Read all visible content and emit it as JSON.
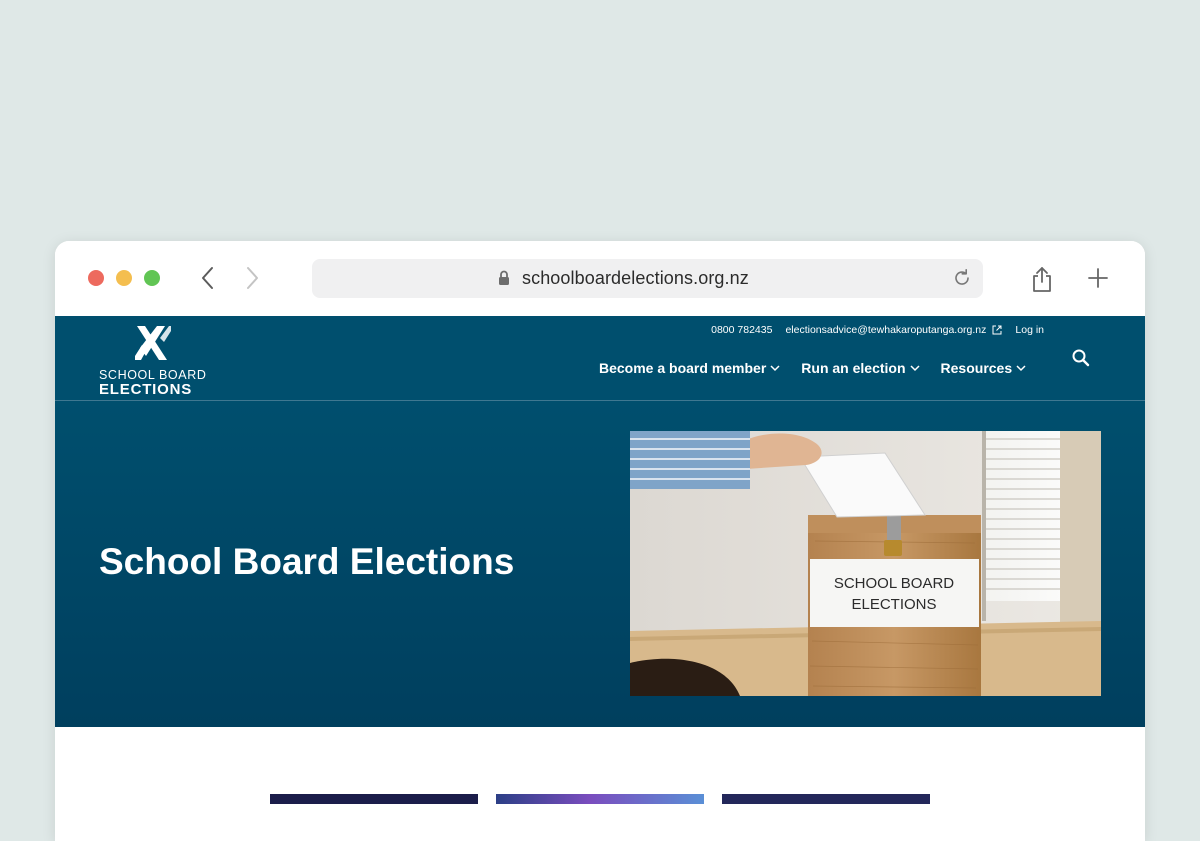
{
  "browser": {
    "url": "schoolboardelections.org.nz",
    "icons": {
      "back": "chevron-left-icon",
      "forward": "chevron-right-icon",
      "lock": "lock-icon",
      "reload": "reload-icon",
      "share": "share-icon",
      "new_tab": "plus-icon"
    }
  },
  "header": {
    "logo": {
      "line1": "SCHOOL BOARD",
      "line2": "ELECTIONS"
    },
    "utility": {
      "phone": "0800 782435",
      "email": "electionsadvice@tewhakaroputanga.org.nz",
      "login": "Log in"
    },
    "nav": [
      {
        "label": "Become a board member"
      },
      {
        "label": "Run an election"
      },
      {
        "label": "Resources"
      }
    ],
    "search_icon": "search-icon"
  },
  "hero": {
    "title": "School Board Elections",
    "image": {
      "sign_line1": "SCHOOL BOARD",
      "sign_line2": "ELECTIONS"
    }
  },
  "colors": {
    "page_background": "#dfe8e7",
    "header": "#004f6e",
    "hero_top": "#004f6e",
    "hero_bottom": "#003f5e",
    "text_on_dark": "#ffffff"
  }
}
